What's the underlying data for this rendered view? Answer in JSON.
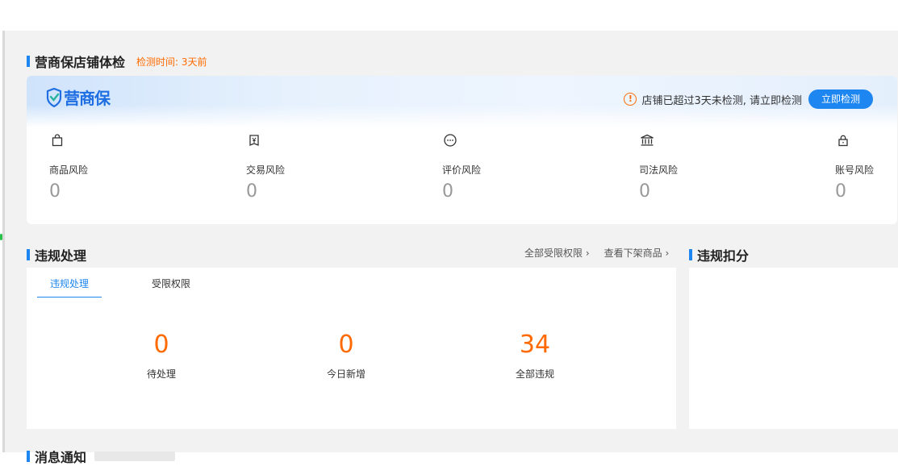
{
  "health": {
    "title": "营商保店铺体检",
    "check_time": "检测时间: 3天前",
    "logo_text": "营商保",
    "warning": "店铺已超过3天未检测, 请立即检测",
    "check_button": "立即检测",
    "risks": [
      {
        "label": "商品风险",
        "value": "0",
        "icon": "shopping-bag-icon"
      },
      {
        "label": "交易风险",
        "value": "0",
        "icon": "yuan-receipt-icon"
      },
      {
        "label": "评价风险",
        "value": "0",
        "icon": "chat-bubble-icon"
      },
      {
        "label": "司法风险",
        "value": "0",
        "icon": "courthouse-icon"
      },
      {
        "label": "账号风险",
        "value": "0",
        "icon": "lock-icon"
      }
    ]
  },
  "violation": {
    "title": "违规处理",
    "links": [
      "全部受限权限 ›",
      "查看下架商品 ›"
    ],
    "tabs": [
      "违规处理",
      "受限权限"
    ],
    "stats": [
      {
        "value": "0",
        "label": "待处理"
      },
      {
        "value": "0",
        "label": "今日新增"
      },
      {
        "value": "34",
        "label": "全部违规"
      }
    ]
  },
  "score": {
    "title": "违规扣分"
  },
  "next_section": {
    "title": "消息通知"
  },
  "colors": {
    "accent": "#1d86f0",
    "warning": "#ff6a00",
    "background": "#f2f2f2"
  }
}
